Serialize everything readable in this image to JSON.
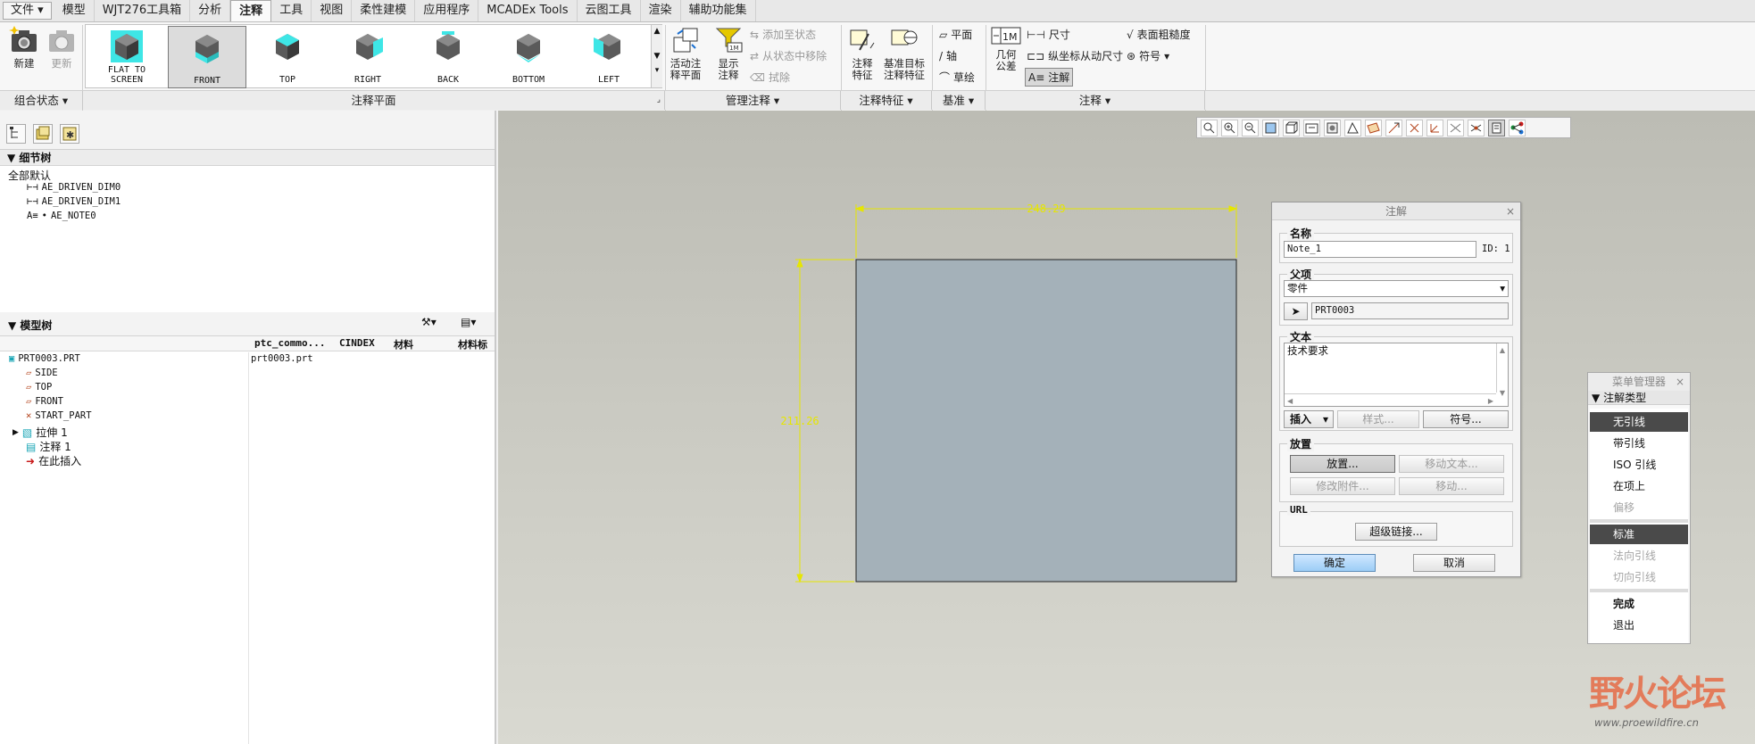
{
  "menubar": {
    "file": "文件",
    "tabs": [
      "模型",
      "WJT276工具箱",
      "分析",
      "注释",
      "工具",
      "视图",
      "柔性建模",
      "应用程序",
      "MCADEx Tools",
      "云图工具",
      "渲染",
      "辅助功能集"
    ],
    "active_index": 3
  },
  "ribbon": {
    "new_label": "新建",
    "update_label": "更新",
    "gallery": [
      {
        "label1": "FLAT  TO",
        "label2": "SCREEN"
      },
      {
        "label1": "",
        "label2": "FRONT"
      },
      {
        "label1": "",
        "label2": "TOP"
      },
      {
        "label1": "",
        "label2": "RIGHT"
      },
      {
        "label1": "",
        "label2": "BACK"
      },
      {
        "label1": "",
        "label2": "BOTTOM"
      },
      {
        "label1": "",
        "label2": "LEFT"
      }
    ],
    "gallery_selected": 1,
    "activate_plane_1": "活动注",
    "activate_plane_2": "释平面",
    "show_note_1": "显示",
    "show_note_2": "注释",
    "add_to_state": "添加至状态",
    "remove_from_state": "从状态中移除",
    "erase": "拭除",
    "note_feature_1": "注释",
    "note_feature_2": "特征",
    "datum_target_1": "基准目标",
    "datum_target_2": "注释特征",
    "plane": "平面",
    "axis": "轴",
    "sketch": "草绘",
    "geo_tol_1": "几何",
    "geo_tol_2": "公差",
    "dimension": "尺寸",
    "ordinate_dim": "纵坐标从动尺寸",
    "annotation": "注解",
    "surface_finish": "表面粗糙度",
    "symbol": "符号",
    "groups": {
      "combo_state": "组合状态",
      "annotation_plane": "注释平面",
      "manage_annotations": "管理注释",
      "annotation_features": "注释特征",
      "datum": "基准",
      "annotations": "注释"
    }
  },
  "leftpanel": {
    "detail_tree_title": "细节树",
    "detail_root": "全部默认",
    "detail_items": [
      "AE_DRIVEN_DIM0",
      "AE_DRIVEN_DIM1",
      "AE_NOTE0"
    ],
    "model_tree_title": "模型树",
    "columns": [
      "ptc_commo...",
      "CINDEX",
      "材料",
      "材料标"
    ],
    "root": "PRT0003.PRT",
    "root_value": "prt0003.prt",
    "items": [
      "SIDE",
      "TOP",
      "FRONT",
      "START_PART",
      "拉伸 1",
      "注释 1",
      "在此插入"
    ]
  },
  "canvas": {
    "dim_width": "248.29",
    "dim_height": "211.26",
    "colors": {
      "part_fill": "#a4b1b9",
      "dim_line": "#e6e600"
    }
  },
  "dialog": {
    "title": "注解",
    "close": "×",
    "name_label": "名称",
    "name_value": "Note_1",
    "id_label": "ID: 1",
    "parent_label": "父项",
    "parent_type": "零件",
    "parent_ref": "PRT0003",
    "text_label": "文本",
    "text_value": "技术要求",
    "insert_btn": "插入",
    "style_btn": "样式...",
    "symbol_btn": "符号...",
    "placement_label": "放置",
    "place_btn": "放置...",
    "move_text_btn": "移动文本...",
    "modify_attach_btn": "修改附件...",
    "move_btn": "移动...",
    "url_label": "URL",
    "hyperlink_btn": "超级链接...",
    "ok_btn": "确定",
    "cancel_btn": "取消"
  },
  "menumgr": {
    "title": "菜单管理器",
    "close": "×",
    "sub": "注解类型",
    "items": [
      {
        "label": "无引线",
        "state": "selected"
      },
      {
        "label": "带引线",
        "state": "normal"
      },
      {
        "label": "ISO 引线",
        "state": "normal"
      },
      {
        "label": "在项上",
        "state": "normal"
      },
      {
        "label": "偏移",
        "state": "disabled"
      },
      {
        "label": "标准",
        "state": "selected"
      },
      {
        "label": "法向引线",
        "state": "disabled"
      },
      {
        "label": "切向引线",
        "state": "disabled"
      },
      {
        "label": "完成",
        "state": "normal"
      },
      {
        "label": "退出",
        "state": "normal"
      }
    ]
  },
  "watermark": {
    "text": "野火论坛",
    "url": "www.proewildfire.cn"
  }
}
